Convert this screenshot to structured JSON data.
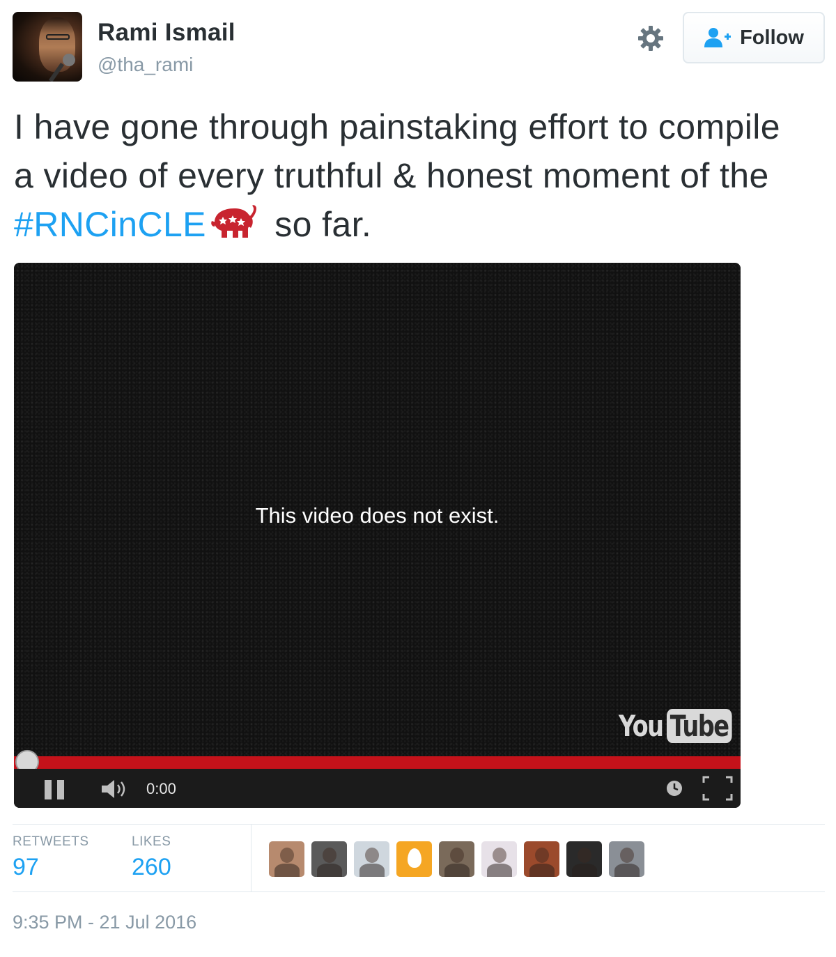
{
  "author": {
    "display_name": "Rami Ismail",
    "screen_name": "@tha_rami"
  },
  "actions": {
    "settings_icon": "gear-icon",
    "follow_label": "Follow",
    "follow_icon": "add-user-icon"
  },
  "tweet": {
    "text_before": "I have gone through painstaking effort to compile a video of every truthful & honest moment of the ",
    "hashtag": "#RNCinCLE",
    "hashtag_icon": "elephant-icon",
    "text_after": " so far."
  },
  "video": {
    "message": "This video does not exist.",
    "time": "0:00",
    "logo_you": "You",
    "logo_tube": "Tube",
    "progress": 0
  },
  "stats": {
    "retweets_label": "RETWEETS",
    "retweets_value": "97",
    "likes_label": "LIKES",
    "likes_value": "260"
  },
  "likers": [
    {
      "name": "liker-1",
      "color": "#b78a6e"
    },
    {
      "name": "liker-2",
      "color": "#5a5a5a"
    },
    {
      "name": "liker-3",
      "color": "#cfd7de"
    },
    {
      "name": "liker-4",
      "color": "#f5a623"
    },
    {
      "name": "liker-5",
      "color": "#7a6a5a"
    },
    {
      "name": "liker-6",
      "color": "#e7e1e8"
    },
    {
      "name": "liker-7",
      "color": "#9b4a2c"
    },
    {
      "name": "liker-8",
      "color": "#2a2a2a"
    },
    {
      "name": "liker-9",
      "color": "#8a8f96"
    }
  ],
  "timestamp": "9:35 PM - 21 Jul 2016",
  "colors": {
    "link": "#1da1f2",
    "progress": "#c4121a",
    "elephant": "#c8242f"
  }
}
